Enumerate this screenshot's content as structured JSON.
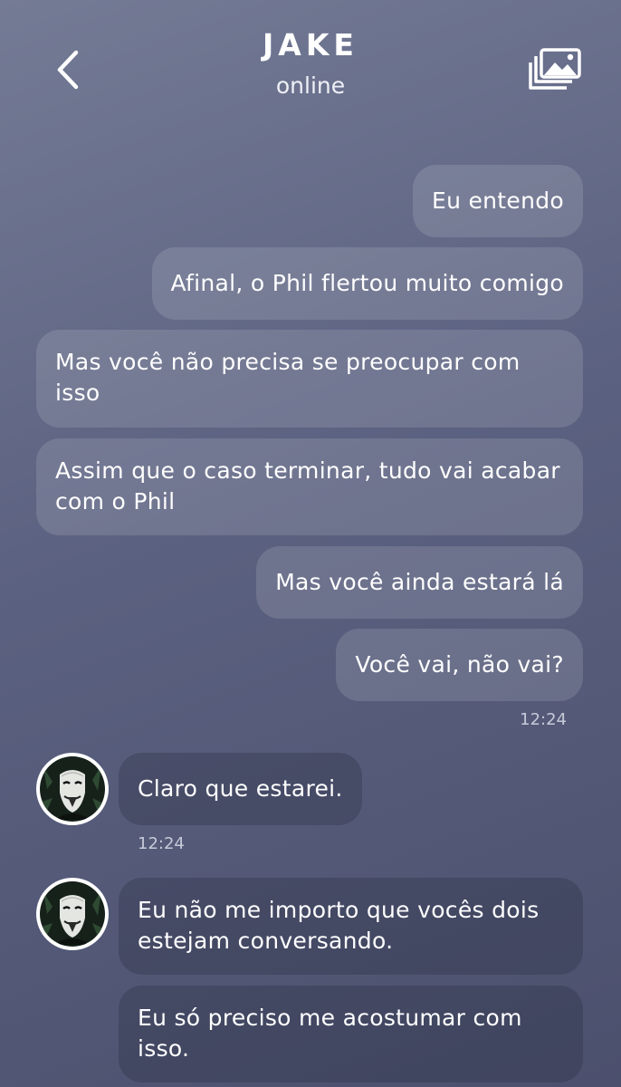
{
  "header": {
    "contact_name": "JAKE",
    "status": "online",
    "back_icon": "chevron-left-icon",
    "gallery_icon": "gallery-icon"
  },
  "messages": [
    {
      "direction": "outgoing",
      "text": "Eu entendo"
    },
    {
      "direction": "outgoing",
      "text": "Afinal, o Phil flertou muito comigo"
    },
    {
      "direction": "outgoing",
      "text": "Mas você não precisa se preocupar com isso"
    },
    {
      "direction": "outgoing",
      "text": "Assim que o caso terminar, tudo vai acabar com o Phil"
    },
    {
      "direction": "outgoing",
      "text": "Mas você ainda estará lá"
    },
    {
      "direction": "outgoing",
      "text": "Você vai, não vai?"
    },
    {
      "direction": "incoming",
      "text": "Claro que estarei."
    },
    {
      "direction": "incoming",
      "text": "Eu não me importo que vocês dois estejam conversando."
    },
    {
      "direction": "incoming",
      "text": "Eu só preciso me acostumar com isso."
    }
  ],
  "timestamps": {
    "outgoing_group": "12:24",
    "incoming_group": "12:24"
  },
  "colors": {
    "background_top": "#747b95",
    "background_bottom": "#4b506d",
    "text": "#ffffff"
  }
}
